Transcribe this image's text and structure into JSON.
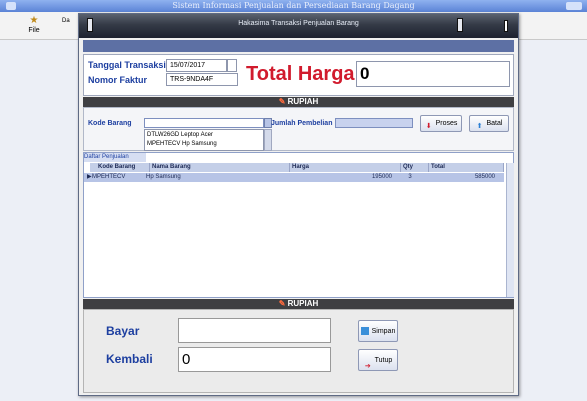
{
  "app": {
    "title": "Sistem Informasi Penjualan dan Persediaan Barang Dagang",
    "toolbar": {
      "file_label": "File",
      "cut_label": "Da"
    }
  },
  "dialog": {
    "title": "Hakasima Transaksi Penjualan Barang",
    "tanggal_label": "Tanggal Transaksi",
    "tanggal_value": "15/07/2017",
    "faktur_label": "Nomor Faktur",
    "faktur_value": "TRS-9NDA4F",
    "total_label": "Total Harga",
    "total_value": "0",
    "rupiah_label": "RUPIAH",
    "kode_label": "Kode Barang",
    "kode_value": "",
    "suggestions": [
      "DTLW26GD  Leptop Acer",
      "MPEHTECV   Hp Samsung"
    ],
    "jumlah_label": "Jumlah Pembelian",
    "proses_label": "Proses",
    "batal_label": "Batal",
    "grid_tab": "Daftar Penjualan",
    "columns": [
      "Kode Barang",
      "Nama Barang",
      "Harga",
      "Qty",
      "Total"
    ],
    "rows": [
      {
        "kode": "MPEHTECV",
        "nama": "Hp Samsung",
        "harga": "195000",
        "qty": "3",
        "total": "585000"
      }
    ],
    "bayar_label": "Bayar",
    "bayar_value": "",
    "kembali_label": "Kembali",
    "kembali_value": "0",
    "simpan_label": "Simpan",
    "tutup_label": "Tutup"
  },
  "colors": {
    "accent": "#d11b2d",
    "label_blue": "#1d3fa0",
    "row_selected": "#b7c4e6"
  }
}
